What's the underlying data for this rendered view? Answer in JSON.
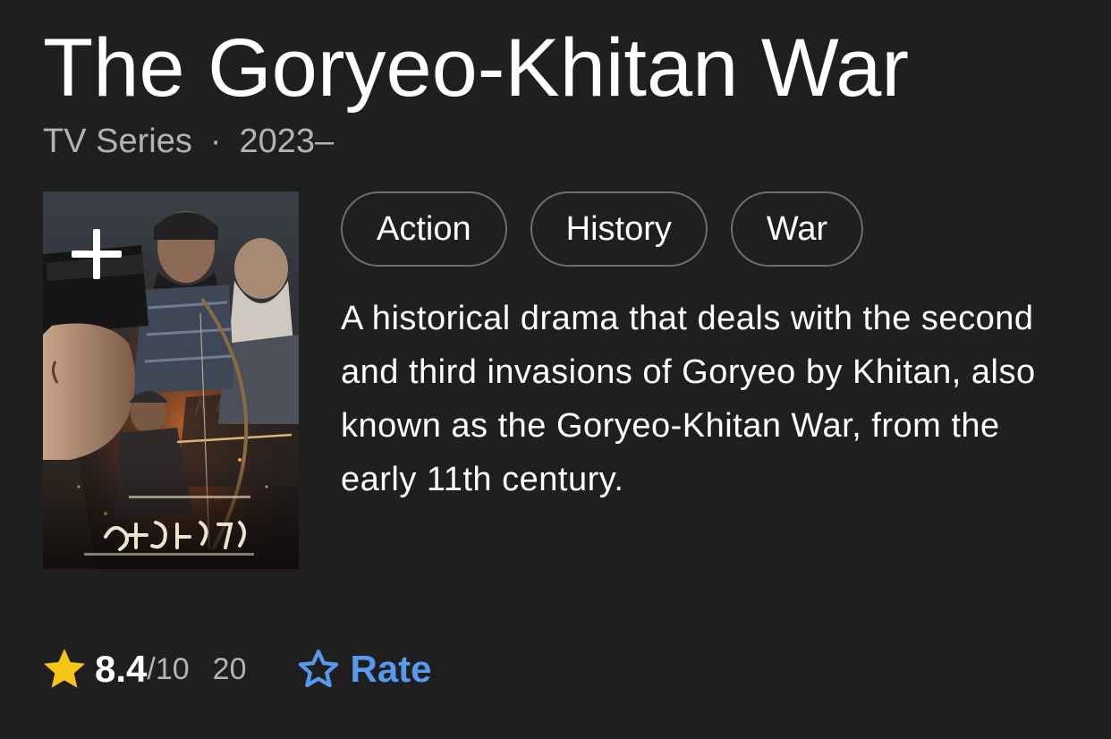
{
  "title": "The Goryeo-Khitan War",
  "meta": {
    "type": "TV Series",
    "separator": "·",
    "years": "2023–"
  },
  "poster": {
    "alt": "poster-image",
    "icon": "plus-icon"
  },
  "genres": [
    "Action",
    "History",
    "War"
  ],
  "description": "A historical drama that deals with the second and third invasions of Goryeo by Khitan, also known as the Goryeo-Khitan War, from the early 11th century.",
  "rating": {
    "icon": "star-icon",
    "score": "8.4",
    "out_of": "/10",
    "count": "20"
  },
  "rate": {
    "icon": "star-outline-icon",
    "label": "Rate"
  },
  "colors": {
    "background": "#1f1f1f",
    "star": "#f5c518",
    "accent": "#5799ef",
    "muted": "#b3b3b3"
  }
}
